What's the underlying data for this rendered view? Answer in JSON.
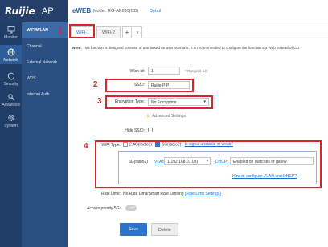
{
  "brand": {
    "logo": "Ruijie",
    "product": "AP"
  },
  "header": {
    "web_logo": "eWEB",
    "model": "Model: RG-AP630(CD)",
    "detail": "Detail"
  },
  "nav": [
    {
      "label": "Monitor",
      "icon": "monitor-icon"
    },
    {
      "label": "Network",
      "icon": "globe-icon"
    },
    {
      "label": "Security",
      "icon": "shield-icon"
    },
    {
      "label": "Advanced",
      "icon": "wrench-icon"
    },
    {
      "label": "System",
      "icon": "gear-icon"
    }
  ],
  "subnav": [
    "WiFi/WLAN",
    "Channel",
    "External Network",
    "WDS",
    "Internet Auth"
  ],
  "tabs": {
    "wifi1": "WiFi-1",
    "wifi2": "WiFi-2",
    "add": "+",
    "more": "v"
  },
  "note": {
    "prefix": "Note:",
    "text": " This function is designed for ease of use based on user scenario. It is recommended to configure the function via Web instead of CLI."
  },
  "form": {
    "wlan_id_label": "Wlan Id:",
    "wlan_id_value": "1",
    "wlan_id_hint": "* Range(1-14)",
    "ssid_label": "SSID:",
    "ssid_value": "Ruijie-PIP",
    "encryption_label": "Encryption Type:",
    "encryption_value": "No Encryption",
    "advanced_settings": "Advanced Settings",
    "hide_ssid_label": "Hide SSID:",
    "wifi_type_label": "WiFi Type:",
    "radio1": "2.4G(radio1)",
    "radio2": "5G(radio2)",
    "signal_link": "Is signal unstable or weak?",
    "radio2_tag": "5G(radio2)",
    "vlan_label": "VLAN:",
    "vlan_value": "1(192.168.0.109)",
    "dhcp_label": "DHCP:",
    "dhcp_value": "Enabled on switches or gatew",
    "config_link": "How to configure VLAN and DHCP?",
    "rate_limit_label": "Rate Limit:",
    "rate_limit_text": "No Rate Limit/Smart Rate Limiting",
    "rate_limit_link": "[Rate Limit Settings]",
    "access_priority_label": "Access priority 5G:",
    "toggle_off": "OFF",
    "save": "Save",
    "delete": "Delete"
  },
  "callouts": [
    "1",
    "2",
    "3",
    "4"
  ],
  "colors": {
    "nav_bg": "#1f3d66",
    "accent": "#2a73c8",
    "callout": "#d9262b"
  }
}
